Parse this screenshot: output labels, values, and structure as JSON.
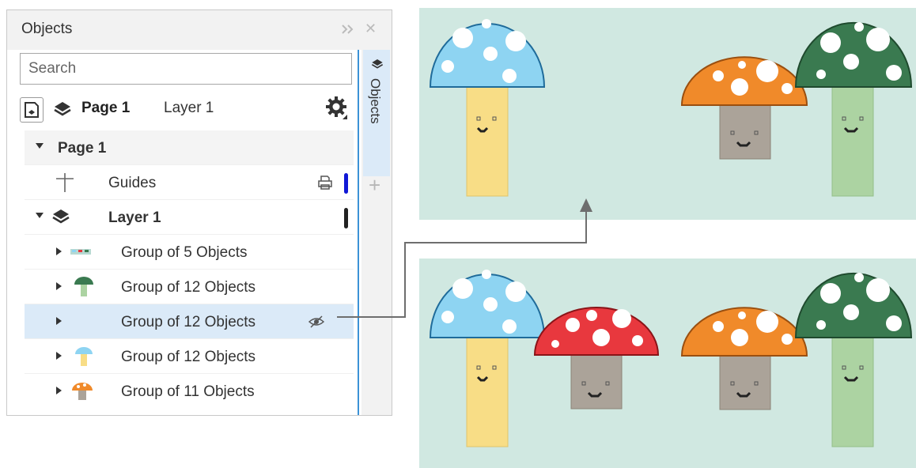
{
  "docker": {
    "title": "Objects",
    "search_placeholder": "Search",
    "page_bar": {
      "page": "Page 1",
      "layer": "Layer 1"
    },
    "side_tab": "Objects",
    "tree": {
      "page_row": "Page 1",
      "guides_row": "Guides",
      "layer_row": "Layer 1",
      "items": [
        {
          "label": "Group of 5 Objects"
        },
        {
          "label": "Group of 12 Objects"
        },
        {
          "label": "Group of 12 Objects",
          "selected": true,
          "hidden": true
        },
        {
          "label": "Group of 12 Objects"
        },
        {
          "label": "Group of 11 Objects"
        }
      ]
    }
  },
  "colors": {
    "canvas_bg": "#d0e8e1",
    "selection": "#dbeaf8",
    "accent_blue": "#3c92d6",
    "guides_layer": "#1018d6",
    "mushroom_blue_cap": "#8ed4f2",
    "mushroom_blue_stem": "#f8dd86",
    "mushroom_red_cap": "#e8383e",
    "mushroom_orange_cap": "#f08a2a",
    "mushroom_green_cap": "#3a7a50",
    "mushroom_green_stem": "#acd3a2",
    "mushroom_gray_stem": "#aba399"
  }
}
